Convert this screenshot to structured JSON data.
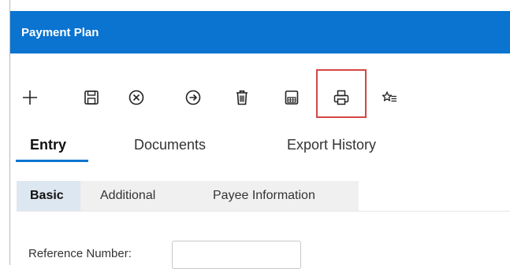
{
  "header": {
    "title": "Payment Plan"
  },
  "toolbar": {
    "buttons": [
      {
        "name": "add",
        "icon": "plus-icon"
      },
      {
        "name": "save",
        "icon": "save-icon"
      },
      {
        "name": "cancel",
        "icon": "close-circle-icon"
      },
      {
        "name": "forward",
        "icon": "arrow-right-circle-icon"
      },
      {
        "name": "delete",
        "icon": "trash-icon"
      },
      {
        "name": "calculator",
        "icon": "calculator-icon"
      },
      {
        "name": "print",
        "icon": "printer-icon",
        "highlighted": true
      },
      {
        "name": "favorite",
        "icon": "star-list-icon"
      }
    ]
  },
  "tabs": [
    {
      "label": "Entry",
      "active": true
    },
    {
      "label": "Documents",
      "active": false
    },
    {
      "label": "Export History",
      "active": false
    }
  ],
  "subtabs": [
    {
      "label": "Basic",
      "active": true
    },
    {
      "label": "Additional",
      "active": false
    },
    {
      "label": "Payee Information",
      "active": false
    }
  ],
  "form": {
    "reference_number": {
      "label": "Reference Number:",
      "value": ""
    }
  },
  "colors": {
    "header_bg": "#0a74d0",
    "accent": "#0a74d0",
    "highlight": "#d54646"
  }
}
